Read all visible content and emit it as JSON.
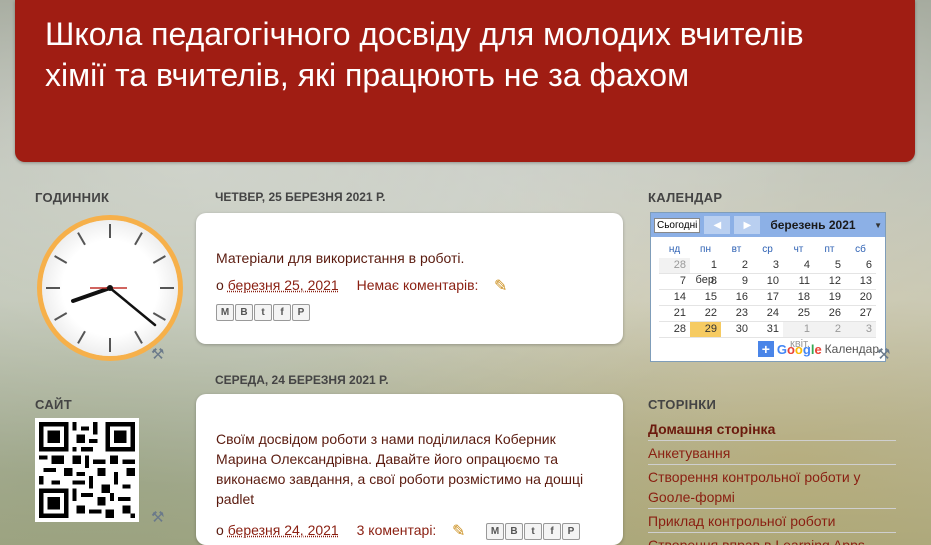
{
  "header": {
    "title": "Школа педагогічного досвіду для молодих вчителів хімії та вчителів, які працюють не за фахом"
  },
  "left": {
    "clock_title": "ГОДИННИК",
    "site_title": "САЙТ"
  },
  "posts": [
    {
      "date": "ЧЕТВЕР, 25 БЕРЕЗНЯ 2021 Р.",
      "text": "Матеріали для використання в роботі.",
      "prefix": "о",
      "time_link": "березня 25, 2021",
      "comments": "Немає коментарів:"
    },
    {
      "date": "СЕРЕДА, 24 БЕРЕЗНЯ 2021 Р.",
      "text": "Своїм досвідом роботи з нами поділилася Коберник Марина Олександрівна. Давайте його опрацюємо та виконаємо завдання, а свої роботи розмістимо на дошці padlet",
      "prefix": "о",
      "time_link": "березня 24, 2021",
      "comments": "3 коментарі:"
    }
  ],
  "share_icons": [
    "M",
    "B",
    "t",
    "f",
    "P"
  ],
  "calendar": {
    "title": "КАЛЕНДАР",
    "today_button": "Сьогодні",
    "month": "березень 2021",
    "weekdays": [
      "нд",
      "пн",
      "вт",
      "ср",
      "чт",
      "пт",
      "сб"
    ],
    "weeks": [
      [
        "28",
        "1 бер.",
        "2",
        "3",
        "4",
        "5",
        "6"
      ],
      [
        "7",
        "8",
        "9",
        "10",
        "11",
        "12",
        "13"
      ],
      [
        "14",
        "15",
        "16",
        "17",
        "18",
        "19",
        "20"
      ],
      [
        "21",
        "22",
        "23",
        "24",
        "25",
        "26",
        "27"
      ],
      [
        "28",
        "29",
        "30",
        "31",
        "1 квіт.",
        "2",
        "3"
      ]
    ],
    "google_label": "Google",
    "calendar_label": "Календар"
  },
  "pages": {
    "title": "СТОРІНКИ",
    "items": [
      "Домашня сторінка",
      "Анкетування",
      "Створення контрольної роботи у Gooле-формі",
      "Приклад контрольної роботи",
      "Створення вправ в Learning Apps"
    ]
  },
  "colors": {
    "header": "#a01d13",
    "link": "#8a1f11"
  }
}
